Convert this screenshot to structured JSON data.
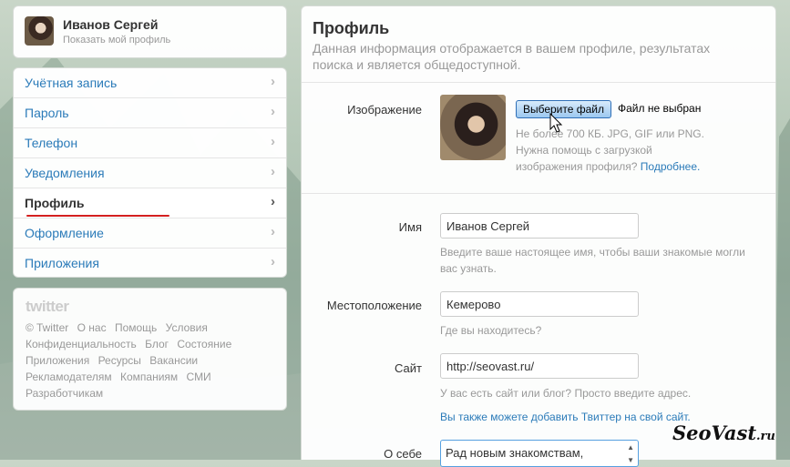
{
  "user": {
    "name": "Иванов Сергей",
    "show_profile": "Показать мой профиль"
  },
  "nav": {
    "items": [
      {
        "label": "Учётная запись"
      },
      {
        "label": "Пароль"
      },
      {
        "label": "Телефон"
      },
      {
        "label": "Уведомления"
      },
      {
        "label": "Профиль",
        "active": true
      },
      {
        "label": "Оформление"
      },
      {
        "label": "Приложения"
      }
    ],
    "chevron": "›"
  },
  "footer": {
    "logo": "twitter",
    "links": [
      "© Twitter",
      "О нас",
      "Помощь",
      "Условия",
      "Конфиденциальность",
      "Блог",
      "Состояние",
      "Приложения",
      "Ресурсы",
      "Вакансии",
      "Рекламодателям",
      "Компаниям",
      "СМИ",
      "Разработчикам"
    ]
  },
  "main": {
    "title": "Профиль",
    "description": "Данная информация отображается в вашем профиле, результатах поиска и является общедоступной.",
    "image": {
      "label": "Изображение",
      "button": "Выберите файл",
      "status": "Файл не выбран",
      "hint": "Не более 700 КБ. JPG, GIF или PNG. Нужна помощь с загрузкой изображения профиля?",
      "hint_link": "Подробнее."
    },
    "name": {
      "label": "Имя",
      "value": "Иванов Сергей",
      "hint": "Введите ваше настоящее имя, чтобы ваши знакомые могли вас узнать."
    },
    "location": {
      "label": "Местоположение",
      "value": "Кемерово",
      "hint": "Где вы находитесь?"
    },
    "site": {
      "label": "Сайт",
      "value": "http://seovast.ru/",
      "hint": "У вас есть сайт или блог? Просто введите адрес.",
      "also": "Вы также можете добавить Твиттер на свой сайт."
    },
    "bio": {
      "label": "О себе",
      "value": "Рад новым знакомствам,"
    }
  },
  "watermark": {
    "main": "SeoVast",
    "suffix": ".ru"
  },
  "colors": {
    "link": "#2b7bb9",
    "hint": "#999999",
    "underline": "#d42020"
  }
}
